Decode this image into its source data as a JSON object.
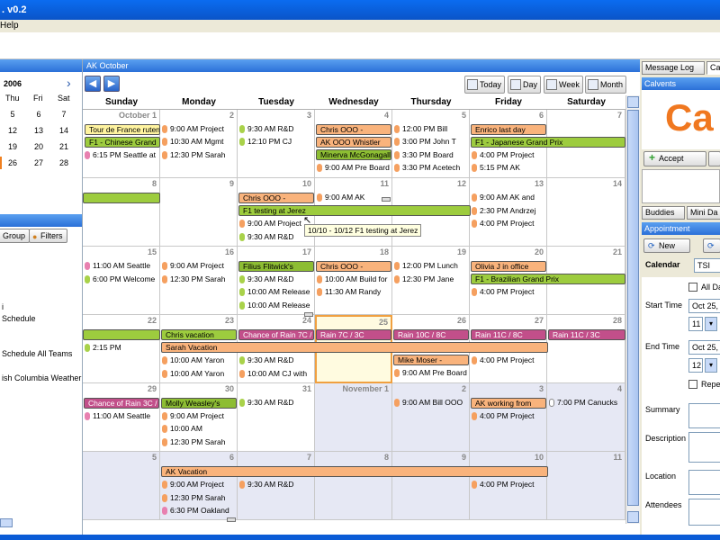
{
  "window": {
    "title": ". v0.2"
  },
  "menu": {
    "help": "Help"
  },
  "left": {
    "mini_year": "2006",
    "mini_next": "›",
    "dow": [
      "Thu",
      "Fri",
      "Sat"
    ],
    "weeks": [
      [
        "5",
        "6",
        "7"
      ],
      [
        "12",
        "13",
        "14"
      ],
      [
        "19",
        "20",
        "21"
      ],
      [
        "26",
        "27",
        "28"
      ]
    ],
    "group_btn": "Group",
    "filters_btn": "Filters",
    "tree": [
      "i",
      "Schedule",
      "Schedule All Teams",
      "ish Columbia Weather -"
    ]
  },
  "main": {
    "header": "AK  October",
    "prev_label": "◀",
    "next_label": "▶",
    "views": {
      "today": "Today",
      "day": "Day",
      "week": "Week",
      "month": "Month"
    },
    "days": [
      "Sunday",
      "Monday",
      "Tuesday",
      "Wednesday",
      "Thursday",
      "Friday",
      "Saturday"
    ],
    "weeks": [
      [
        "October 1",
        "2",
        "3",
        "4",
        "5",
        "6",
        "7"
      ],
      [
        "8",
        "9",
        "10",
        "11",
        "12",
        "13",
        "14"
      ],
      [
        "15",
        "16",
        "17",
        "18",
        "19",
        "20",
        "21"
      ],
      [
        "22",
        "23",
        "24",
        "25",
        "26",
        "27",
        "28"
      ],
      [
        "29",
        "30",
        "31",
        "November 1",
        "2",
        "3",
        "4"
      ],
      [
        "5",
        "6",
        "7",
        "8",
        "9",
        "10",
        "11"
      ]
    ],
    "tooltip": "10/10 - 10/12  F1 testing at Jerez",
    "events": {
      "w0_sun_bar1": "Tour de France ruten",
      "w0_sun_bar2": "F1 - Chinese Grand",
      "w0_sun_e1": "6:15 PM Seattle at",
      "w0_mon_e1": "9:00 AM Project",
      "w0_mon_e2": "10:30 AM Mgmt",
      "w0_mon_e3": "12:30 PM Sarah",
      "w0_tue_e1": "9:30 AM R&D",
      "w0_tue_e2": "12:10 PM CJ",
      "w0_wed_bar1": "Chris OOO -",
      "w0_wed_bar2": "AK OOO Whistler",
      "w0_wed_bar3": "Minerva McGonagall",
      "w0_wed_e1": "9:00 AM Pre Board",
      "w0_thu_e1": "12:00 PM Bill",
      "w0_thu_e2": "3:00 PM John T",
      "w0_thu_e3": "3:30 PM Board",
      "w0_thu_e4": "3:30 PM Acetech",
      "w0_fri_bar1": "Enrico last day",
      "w0_fri_bar2": "F1 - Japanese Grand Prix",
      "w0_fri_e1": "4:00 PM Project",
      "w0_fri_e2": "5:15 PM AK",
      "w1_tue_bar1": "Chris OOO -",
      "w1_tue_bar2": "F1 testing at Jerez",
      "w1_tue_e1": "9:00 AM Project",
      "w1_tue_e2": "9:30 AM R&D",
      "w1_wed_e1": "9:00 AM AK",
      "w1_fri_e1": "9:00 AM AK and",
      "w1_fri_e2": "2:30 PM Andrzej",
      "w1_fri_e3": "4:00 PM Project",
      "w2_sun_e1": "11:00 AM Seattle",
      "w2_sun_e2": "6:00 PM Welcome",
      "w2_mon_e1": "9:00 AM Project",
      "w2_mon_e2": "12:30 PM Sarah",
      "w2_tue_bar1": "Filius Flitwick's",
      "w2_tue_e1": "9:30 AM R&D",
      "w2_tue_e2": "10:00 AM Release",
      "w2_tue_e3": "10:00 AM Release",
      "w2_wed_bar1": "Chris OOO -",
      "w2_wed_e1": "10:00 AM Build for",
      "w2_wed_e2": "11:30 AM Randy",
      "w2_thu_e1": "12:00 PM Lunch",
      "w2_thu_e2": "12:30 PM Jane",
      "w2_fri_bar1": "Olivia J in office",
      "w2_fri_bar2": "F1 - Brazilian Grand Prix",
      "w2_fri_e1": "4:00 PM Project",
      "w3_mon_bar1": "Chris vacation",
      "w3_tue_bar1": "Chance of Rain 7C /",
      "w3_wed_bar1": "Rain 7C / 3C",
      "w3_thu_bar1": "Rain 10C / 8C",
      "w3_fri_bar1": "Rain 11C / 8C",
      "w3_sat_bar1": "Rain 11C / 3C",
      "w3_sun_e1": "2:15 PM",
      "w3_mon_bar2": "Sarah Vacation",
      "w3_mon_e1": "10:00 AM Yaron",
      "w3_mon_e2": "10:00 AM Yaron",
      "w3_tue_e1": "9:30 AM R&D",
      "w3_tue_e2": "10:00 AM CJ with",
      "w3_thu_bar1b": "Mike Moser -",
      "w3_thu_e1": "9:00 AM Pre Board",
      "w3_fri_e1": "4:00 PM Project",
      "w4_sun_bar1": "Chance of Rain 3C /",
      "w4_sun_e1": "11:00 AM Seattle",
      "w4_mon_bar1": "Molly Weasley's",
      "w4_mon_e1": "9:00 AM Project",
      "w4_mon_e2": "10:00 AM",
      "w4_mon_e3": "12:30 PM Sarah",
      "w4_tue_e1": "9:30 AM R&D",
      "w4_thu_e1": "9:00 AM Bill OOO",
      "w4_fri_bar1": "AK working from",
      "w4_fri_e1": "4:00 PM Project",
      "w4_sat_e1": "7:00 PM Canucks",
      "w5_mon_bar1": "AK Vacation",
      "w5_mon_e1": "9:00 AM Project",
      "w5_mon_e2": "12:30 PM Sarah",
      "w5_mon_e3": "6:30 PM Oakland",
      "w5_tue_e1": "9:30 AM R&D",
      "w5_fri_e1": "4:00 PM Project"
    }
  },
  "right": {
    "tab_msglog": "Message Log",
    "tab_cal": "Cal",
    "calvents_head": "Calvents",
    "calvents_logo": "Ca",
    "accept_btn": "Accept",
    "tab_buddies": "Buddies",
    "tab_minida": "Mini Da",
    "appointment_head": "Appointment",
    "new_btn": "New",
    "calendar_lbl": "Calendar",
    "calendar_val": "TSI",
    "allday_lbl": "All Da",
    "start_lbl": "Start Time",
    "start_date": "Oct 25,",
    "start_hour": "11",
    "end_lbl": "End Time",
    "end_date": "Oct 25,",
    "end_hour": "12",
    "repeat_lbl": "Repe",
    "summary_lbl": "Summary",
    "description_lbl": "Description",
    "location_lbl": "Location",
    "attendees_lbl": "Attendees"
  }
}
